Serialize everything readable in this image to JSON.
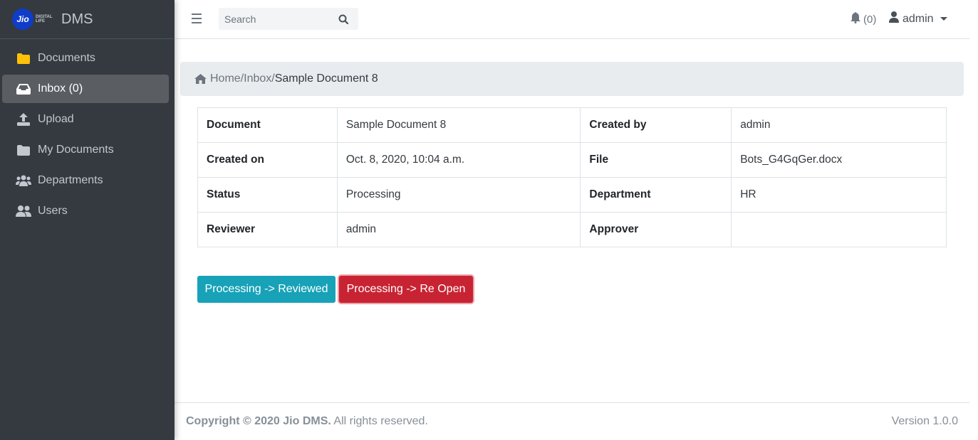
{
  "brand": {
    "logo_text": "Jio",
    "logo_sub": "DIGITAL LIFE",
    "app_name": "DMS"
  },
  "sidebar": {
    "items": [
      {
        "label": "Documents",
        "icon": "folder-icon",
        "color": "#ffc107"
      },
      {
        "label": "Inbox (0)",
        "icon": "inbox-icon",
        "active": true
      },
      {
        "label": "Upload",
        "icon": "upload-icon"
      },
      {
        "label": "My Documents",
        "icon": "folder-icon"
      },
      {
        "label": "Departments",
        "icon": "users-group-icon"
      },
      {
        "label": "Users",
        "icon": "users-icon"
      }
    ]
  },
  "topbar": {
    "search_placeholder": "Search",
    "notifications": "(0)",
    "user": "admin"
  },
  "breadcrumb": {
    "home": "Home",
    "sep1": " /",
    "inbox": "Inbox",
    "sep2": " /",
    "current": "Sample Document 8"
  },
  "details": {
    "rows": [
      {
        "label1": "Document",
        "value1": "Sample Document 8",
        "label2": "Created by",
        "value2": "admin"
      },
      {
        "label1": "Created on",
        "value1": "Oct. 8, 2020, 10:04 a.m.",
        "label2": "File",
        "value2": "Bots_G4GqGer.docx"
      },
      {
        "label1": "Status",
        "value1": "Processing",
        "label2": "Department",
        "value2": "HR"
      },
      {
        "label1": "Reviewer",
        "value1": "admin",
        "label2": "Approver",
        "value2": ""
      }
    ]
  },
  "actions": {
    "review": "Processing -> Reviewed",
    "reopen": "Processing -> Re Open"
  },
  "footer": {
    "copyright_prefix": "Copyright © 2020 ",
    "brand": "Jio DMS.",
    "rights": " All rights reserved.",
    "version": "Version 1.0.0"
  },
  "colors": {
    "sidebar_bg": "#343a40",
    "info": "#17a2b8",
    "danger": "#c82333"
  }
}
